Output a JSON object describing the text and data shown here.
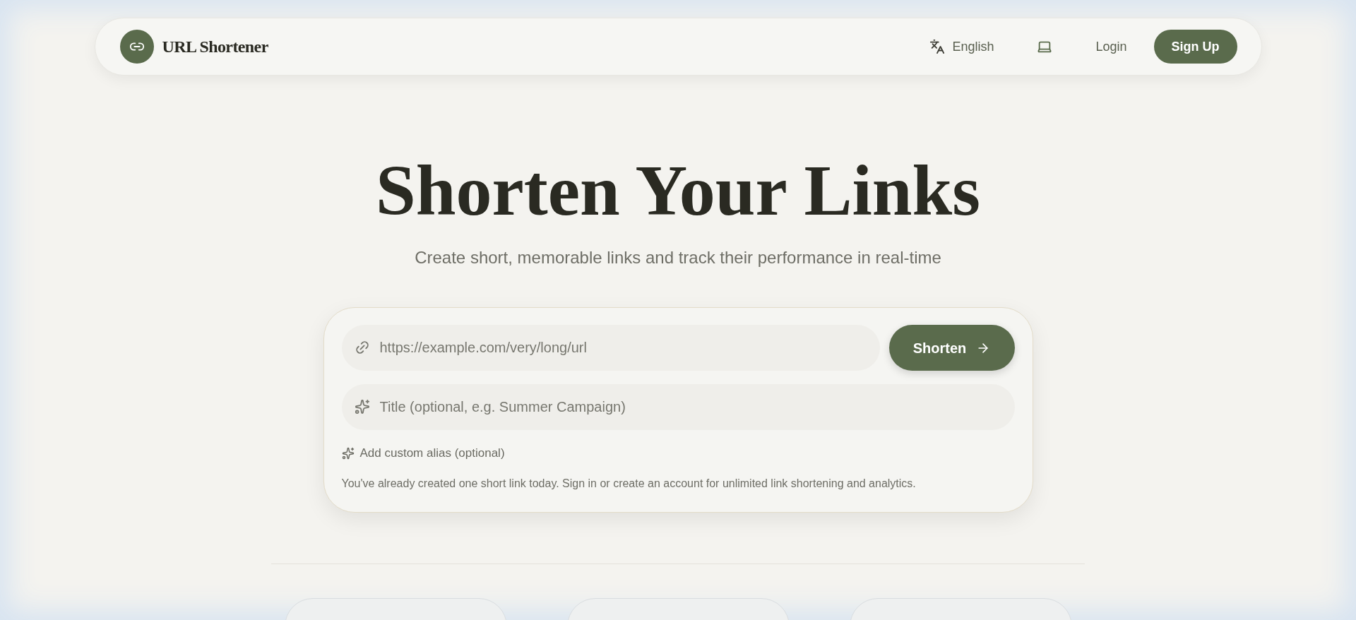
{
  "header": {
    "brand": "URL Shortener",
    "language": "English",
    "login": "Login",
    "signup": "Sign Up"
  },
  "hero": {
    "title": "Shorten Your Links",
    "subtitle": "Create short, memorable links and track their performance in real-time"
  },
  "form": {
    "url_placeholder": "https://example.com/very/long/url",
    "submit": "Shorten",
    "title_placeholder": "Title (optional, e.g. Summer Campaign)",
    "alias_toggle": "Add custom alias (optional)",
    "notice": "You've already created one short link today. Sign in or create an account for unlimited link shortening and analytics."
  }
}
